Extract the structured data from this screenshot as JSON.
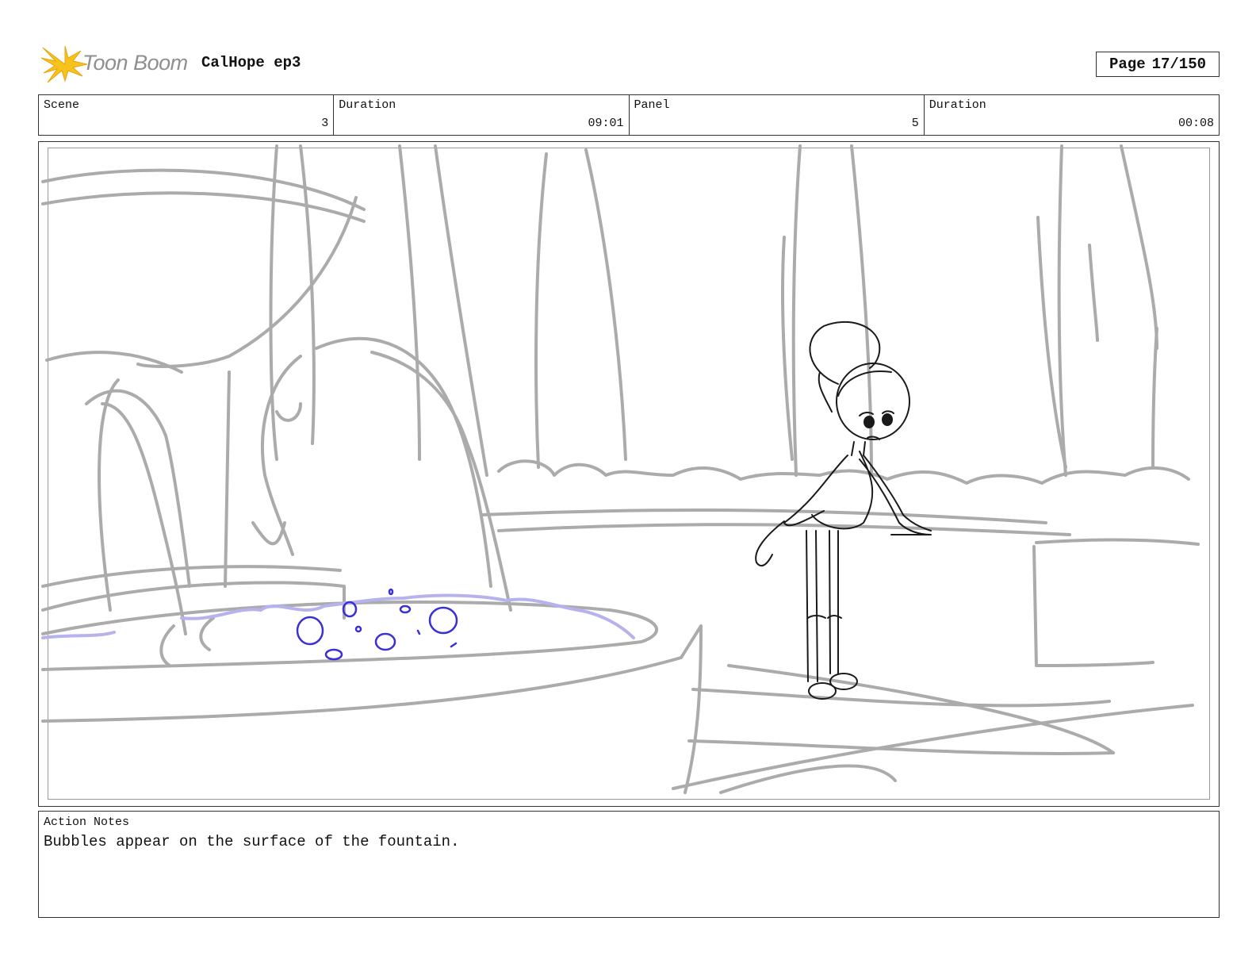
{
  "header": {
    "logo_text": "Toon Boom",
    "project_title": "CalHope ep3",
    "page_label": "Page",
    "page_number": "17/150"
  },
  "info": {
    "scene_label": "Scene",
    "scene_value": "3",
    "scene_duration_label": "Duration",
    "scene_duration_value": "09:01",
    "panel_label": "Panel",
    "panel_value": "5",
    "panel_duration_label": "Duration",
    "panel_duration_value": "00:08"
  },
  "notes": {
    "label": "Action Notes",
    "text": "Bubbles appear on the surface of the fountain."
  },
  "colors": {
    "sketch_gray": "#ababab",
    "character_line": "#1a1a1a",
    "bubble_blue": "#3b2fd6",
    "water_lavender": "#b7b2ee",
    "logo_yellow": "#f7c21b"
  }
}
